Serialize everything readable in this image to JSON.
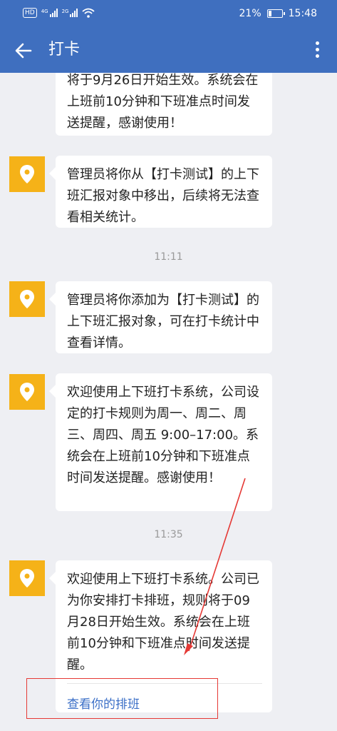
{
  "status_bar": {
    "badge": "HD",
    "sig1": "4G",
    "sig2": "2G",
    "battery": "21%",
    "battery_level": 0.21,
    "time": "15:48"
  },
  "header": {
    "title": "打卡"
  },
  "messages": [
    {
      "text": "将于9月26日开始生效。系统会在上班前10分钟和下班准点时间发送提醒，感谢使用！"
    },
    {
      "text": "管理员将你从【打卡测试】的上下班汇报对象中移出，后续将无法查看相关统计。"
    },
    {
      "text": "管理员将你添加为【打卡测试】的上下班汇报对象，可在打卡统计中查看详情。"
    },
    {
      "text": "欢迎使用上下班打卡系统，公司设定的打卡规则为周一、周二、周三、周四、周五 9:00–17:00。系统会在上班前10分钟和下班准点时间发送提醒。感谢使用！"
    },
    {
      "text": "欢迎使用上下班打卡系统。公司已为你安排打卡排班，规则将于09月28日开始生效。系统会在上班前10分钟和下班准点时间发送提醒。",
      "link": "查看你的排班"
    }
  ],
  "timestamps": [
    "11:11",
    "11:35"
  ],
  "colors": {
    "appbar": "#3f6fbf",
    "avatar": "#f5b218",
    "link": "#3b6fc7",
    "annotation": "#e53935"
  }
}
